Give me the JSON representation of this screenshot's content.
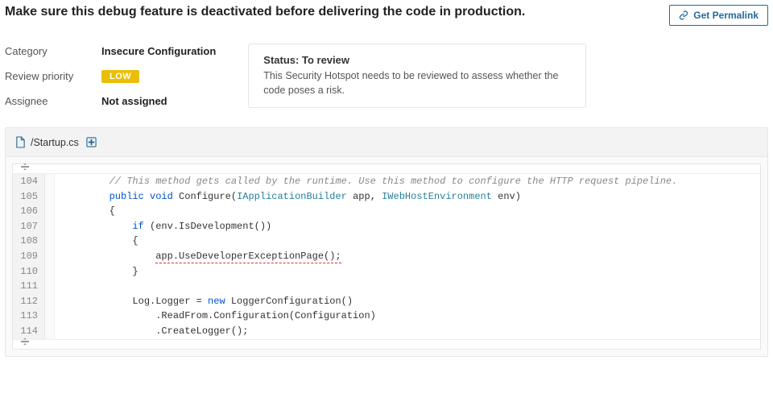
{
  "issue": {
    "title": "Make sure this debug feature is deactivated before delivering the code in production.",
    "permalink_label": "Get Permalink"
  },
  "meta": {
    "category_label": "Category",
    "category_value": "Insecure Configuration",
    "priority_label": "Review priority",
    "priority_value": "LOW",
    "assignee_label": "Assignee",
    "assignee_value": "Not assigned"
  },
  "status": {
    "label": "Status:",
    "value": "To review",
    "description": "This Security Hotspot needs to be reviewed to assess whether the code poses a risk."
  },
  "file": {
    "path": "/Startup.cs"
  },
  "code": {
    "lines": [
      {
        "n": 104,
        "indent": "        ",
        "frags": [
          {
            "t": "// This method gets called by the runtime. Use this method to configure the HTTP request pipeline.",
            "cls": "c-comment"
          }
        ]
      },
      {
        "n": 105,
        "indent": "        ",
        "frags": [
          {
            "t": "public",
            "cls": "c-kw"
          },
          {
            "t": " "
          },
          {
            "t": "void",
            "cls": "c-kw"
          },
          {
            "t": " Configure("
          },
          {
            "t": "IApplicationBuilder",
            "cls": "c-type"
          },
          {
            "t": " app, "
          },
          {
            "t": "IWebHostEnvironment",
            "cls": "c-type"
          },
          {
            "t": " env)"
          }
        ]
      },
      {
        "n": 106,
        "indent": "        ",
        "frags": [
          {
            "t": "{"
          }
        ]
      },
      {
        "n": 107,
        "indent": "            ",
        "frags": [
          {
            "t": "if",
            "cls": "c-kw"
          },
          {
            "t": " (env.IsDevelopment())"
          }
        ]
      },
      {
        "n": 108,
        "indent": "            ",
        "frags": [
          {
            "t": "{"
          }
        ]
      },
      {
        "n": 109,
        "indent": "                ",
        "frags": [
          {
            "t": "app.UseDeveloperExceptionPage();",
            "cls": "underline-red"
          }
        ]
      },
      {
        "n": 110,
        "indent": "            ",
        "frags": [
          {
            "t": "}"
          }
        ]
      },
      {
        "n": 111,
        "indent": "",
        "frags": [
          {
            "t": ""
          }
        ]
      },
      {
        "n": 112,
        "indent": "            ",
        "frags": [
          {
            "t": "Log.Logger = "
          },
          {
            "t": "new",
            "cls": "c-kw"
          },
          {
            "t": " LoggerConfiguration()"
          }
        ]
      },
      {
        "n": 113,
        "indent": "                ",
        "frags": [
          {
            "t": ".ReadFrom.Configuration(Configuration)"
          }
        ]
      },
      {
        "n": 114,
        "indent": "                ",
        "frags": [
          {
            "t": ".CreateLogger();"
          }
        ]
      }
    ]
  }
}
